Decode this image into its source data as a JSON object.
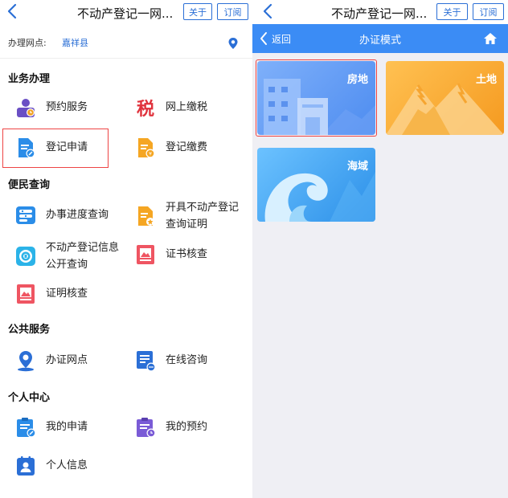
{
  "left": {
    "window_title": "不动产登记一网...",
    "about_label": "关于",
    "subscribe_label": "订阅",
    "site": {
      "label": "办理网点:",
      "value": "嘉祥县"
    },
    "sections": [
      {
        "title": "业务办理",
        "items": [
          {
            "label": "预约服务",
            "icon": "appointment-icon"
          },
          {
            "label": "网上缴税",
            "icon": "tax-icon",
            "icon_text": "税"
          },
          {
            "label": "登记申请",
            "icon": "registration-apply-icon"
          },
          {
            "label": "登记缴费",
            "icon": "registration-fee-icon"
          }
        ]
      },
      {
        "title": "便民查询",
        "items": [
          {
            "label": "办事进度查询",
            "icon": "progress-query-icon"
          },
          {
            "label": "开具不动产登记查询证明",
            "icon": "certificate-issue-icon",
            "line1": "开具不动产登记",
            "line2": "查询证明"
          },
          {
            "label": "不动产登记信息公开查询",
            "icon": "public-info-query-icon",
            "line1": "不动产登记信息",
            "line2": "公开查询"
          },
          {
            "label": "证书核查",
            "icon": "certificate-check-icon"
          },
          {
            "label": "证明核查",
            "icon": "proof-check-icon"
          }
        ]
      },
      {
        "title": "公共服务",
        "items": [
          {
            "label": "办证网点",
            "icon": "service-location-icon"
          },
          {
            "label": "在线咨询",
            "icon": "online-consult-icon"
          }
        ]
      },
      {
        "title": "个人中心",
        "items": [
          {
            "label": "我的申请",
            "icon": "my-application-icon"
          },
          {
            "label": "我的预约",
            "icon": "my-appointment-icon"
          },
          {
            "label": "个人信息",
            "icon": "personal-info-icon"
          }
        ]
      }
    ]
  },
  "right": {
    "window_title": "不动产登记一网...",
    "about_label": "关于",
    "subscribe_label": "订阅",
    "back_label": "返回",
    "page_title": "办证模式",
    "cards": [
      {
        "label": "房地",
        "selected": true
      },
      {
        "label": "土地",
        "selected": false
      },
      {
        "label": "海域",
        "selected": false
      }
    ]
  },
  "colors": {
    "accent": "#3b8cf5",
    "link": "#2b6fd6",
    "highlight": "#ee4444",
    "card_blue": "#5b96f2",
    "card_orange": "#f7a733",
    "card_sea": "#3aa0f0"
  }
}
